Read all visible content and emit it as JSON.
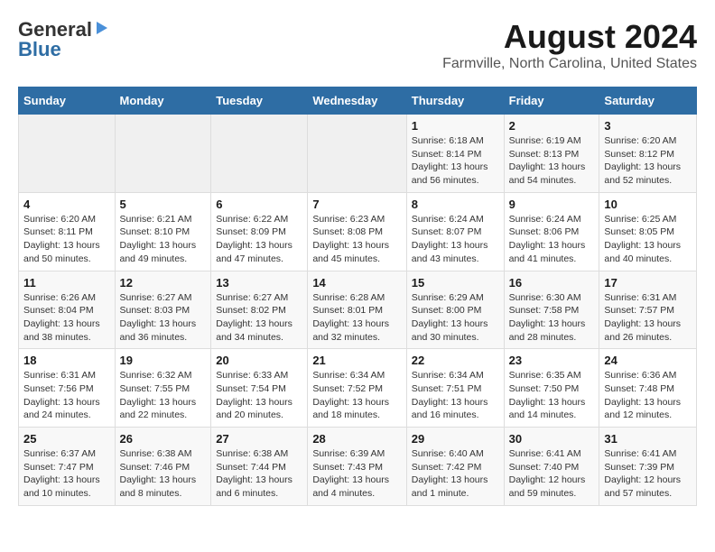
{
  "header": {
    "logo_general": "General",
    "logo_blue": "Blue",
    "main_title": "August 2024",
    "subtitle": "Farmville, North Carolina, United States"
  },
  "calendar": {
    "days_of_week": [
      "Sunday",
      "Monday",
      "Tuesday",
      "Wednesday",
      "Thursday",
      "Friday",
      "Saturday"
    ],
    "weeks": [
      [
        {
          "day": "",
          "info": ""
        },
        {
          "day": "",
          "info": ""
        },
        {
          "day": "",
          "info": ""
        },
        {
          "day": "",
          "info": ""
        },
        {
          "day": "1",
          "info": "Sunrise: 6:18 AM\nSunset: 8:14 PM\nDaylight: 13 hours and 56 minutes."
        },
        {
          "day": "2",
          "info": "Sunrise: 6:19 AM\nSunset: 8:13 PM\nDaylight: 13 hours and 54 minutes."
        },
        {
          "day": "3",
          "info": "Sunrise: 6:20 AM\nSunset: 8:12 PM\nDaylight: 13 hours and 52 minutes."
        }
      ],
      [
        {
          "day": "4",
          "info": "Sunrise: 6:20 AM\nSunset: 8:11 PM\nDaylight: 13 hours and 50 minutes."
        },
        {
          "day": "5",
          "info": "Sunrise: 6:21 AM\nSunset: 8:10 PM\nDaylight: 13 hours and 49 minutes."
        },
        {
          "day": "6",
          "info": "Sunrise: 6:22 AM\nSunset: 8:09 PM\nDaylight: 13 hours and 47 minutes."
        },
        {
          "day": "7",
          "info": "Sunrise: 6:23 AM\nSunset: 8:08 PM\nDaylight: 13 hours and 45 minutes."
        },
        {
          "day": "8",
          "info": "Sunrise: 6:24 AM\nSunset: 8:07 PM\nDaylight: 13 hours and 43 minutes."
        },
        {
          "day": "9",
          "info": "Sunrise: 6:24 AM\nSunset: 8:06 PM\nDaylight: 13 hours and 41 minutes."
        },
        {
          "day": "10",
          "info": "Sunrise: 6:25 AM\nSunset: 8:05 PM\nDaylight: 13 hours and 40 minutes."
        }
      ],
      [
        {
          "day": "11",
          "info": "Sunrise: 6:26 AM\nSunset: 8:04 PM\nDaylight: 13 hours and 38 minutes."
        },
        {
          "day": "12",
          "info": "Sunrise: 6:27 AM\nSunset: 8:03 PM\nDaylight: 13 hours and 36 minutes."
        },
        {
          "day": "13",
          "info": "Sunrise: 6:27 AM\nSunset: 8:02 PM\nDaylight: 13 hours and 34 minutes."
        },
        {
          "day": "14",
          "info": "Sunrise: 6:28 AM\nSunset: 8:01 PM\nDaylight: 13 hours and 32 minutes."
        },
        {
          "day": "15",
          "info": "Sunrise: 6:29 AM\nSunset: 8:00 PM\nDaylight: 13 hours and 30 minutes."
        },
        {
          "day": "16",
          "info": "Sunrise: 6:30 AM\nSunset: 7:58 PM\nDaylight: 13 hours and 28 minutes."
        },
        {
          "day": "17",
          "info": "Sunrise: 6:31 AM\nSunset: 7:57 PM\nDaylight: 13 hours and 26 minutes."
        }
      ],
      [
        {
          "day": "18",
          "info": "Sunrise: 6:31 AM\nSunset: 7:56 PM\nDaylight: 13 hours and 24 minutes."
        },
        {
          "day": "19",
          "info": "Sunrise: 6:32 AM\nSunset: 7:55 PM\nDaylight: 13 hours and 22 minutes."
        },
        {
          "day": "20",
          "info": "Sunrise: 6:33 AM\nSunset: 7:54 PM\nDaylight: 13 hours and 20 minutes."
        },
        {
          "day": "21",
          "info": "Sunrise: 6:34 AM\nSunset: 7:52 PM\nDaylight: 13 hours and 18 minutes."
        },
        {
          "day": "22",
          "info": "Sunrise: 6:34 AM\nSunset: 7:51 PM\nDaylight: 13 hours and 16 minutes."
        },
        {
          "day": "23",
          "info": "Sunrise: 6:35 AM\nSunset: 7:50 PM\nDaylight: 13 hours and 14 minutes."
        },
        {
          "day": "24",
          "info": "Sunrise: 6:36 AM\nSunset: 7:48 PM\nDaylight: 13 hours and 12 minutes."
        }
      ],
      [
        {
          "day": "25",
          "info": "Sunrise: 6:37 AM\nSunset: 7:47 PM\nDaylight: 13 hours and 10 minutes."
        },
        {
          "day": "26",
          "info": "Sunrise: 6:38 AM\nSunset: 7:46 PM\nDaylight: 13 hours and 8 minutes."
        },
        {
          "day": "27",
          "info": "Sunrise: 6:38 AM\nSunset: 7:44 PM\nDaylight: 13 hours and 6 minutes."
        },
        {
          "day": "28",
          "info": "Sunrise: 6:39 AM\nSunset: 7:43 PM\nDaylight: 13 hours and 4 minutes."
        },
        {
          "day": "29",
          "info": "Sunrise: 6:40 AM\nSunset: 7:42 PM\nDaylight: 13 hours and 1 minute."
        },
        {
          "day": "30",
          "info": "Sunrise: 6:41 AM\nSunset: 7:40 PM\nDaylight: 12 hours and 59 minutes."
        },
        {
          "day": "31",
          "info": "Sunrise: 6:41 AM\nSunset: 7:39 PM\nDaylight: 12 hours and 57 minutes."
        }
      ]
    ]
  }
}
